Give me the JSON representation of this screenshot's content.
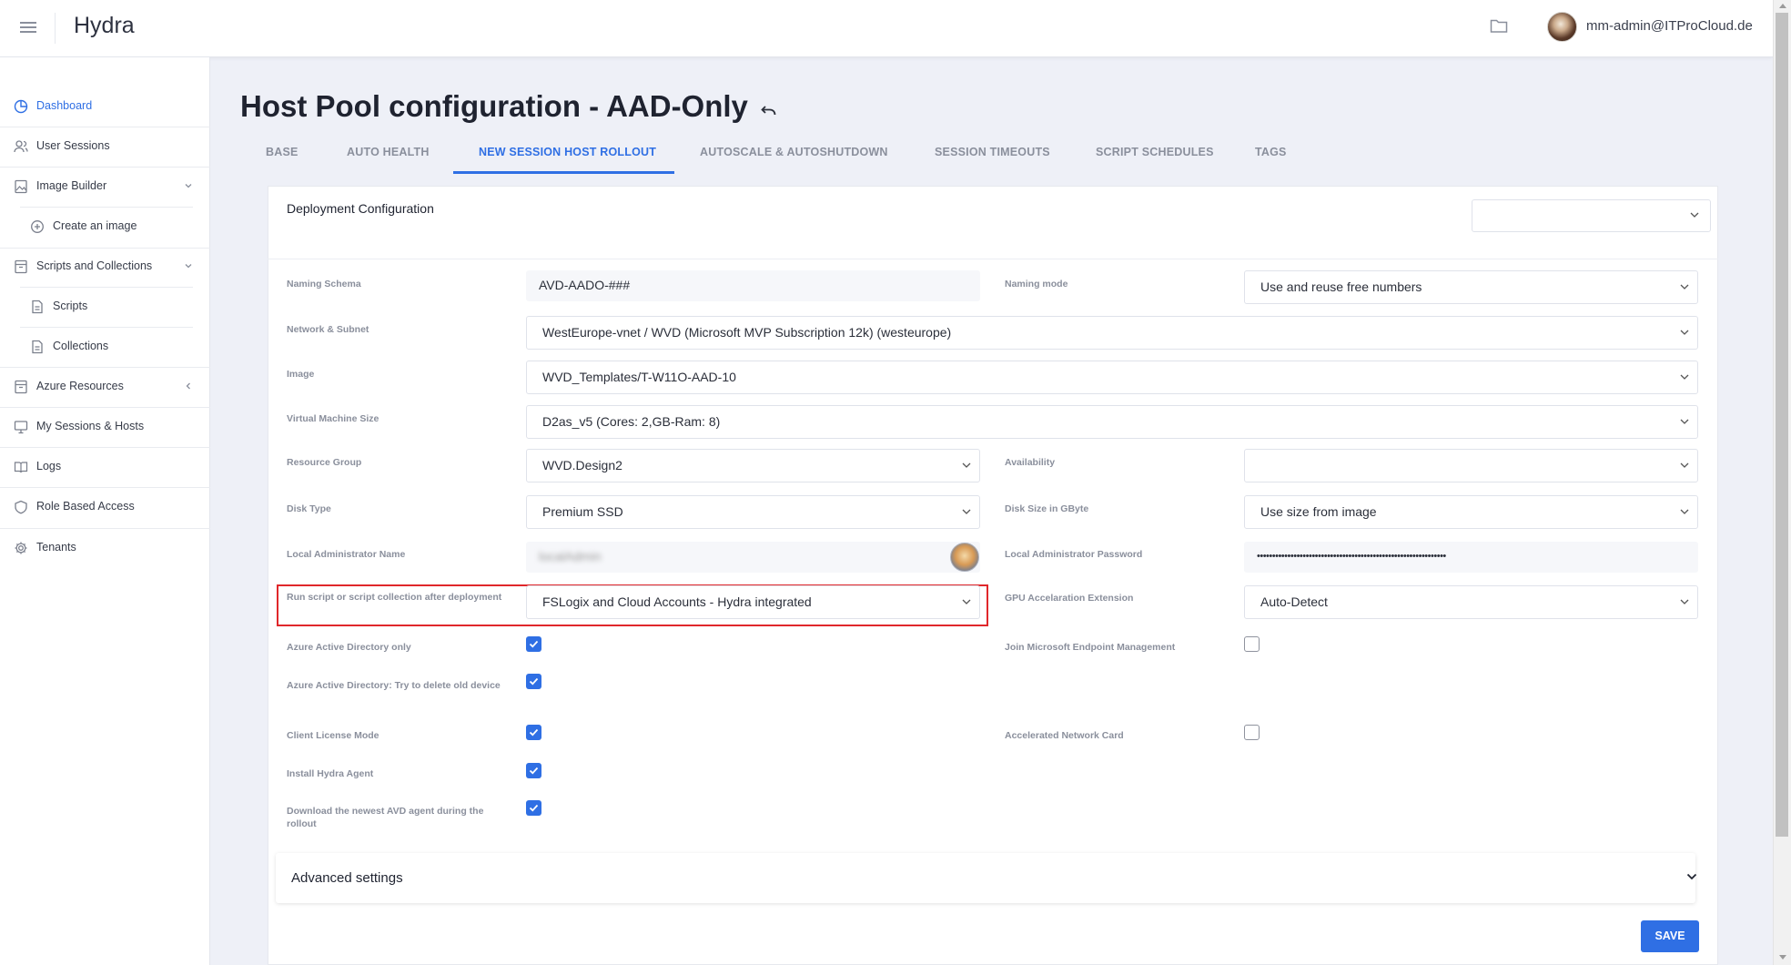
{
  "app": {
    "title": "Hydra"
  },
  "header": {
    "user": "mm-admin@ITProCloud.de"
  },
  "sidebar": {
    "items": [
      {
        "label": "Dashboard",
        "icon": "dashboard-icon"
      },
      {
        "label": "User Sessions",
        "icon": "users-icon"
      },
      {
        "label": "Image Builder",
        "icon": "image-builder-icon"
      },
      {
        "label": "Create an image",
        "icon": "plus-circle-icon"
      },
      {
        "label": "Scripts and Collections",
        "icon": "archive-icon"
      },
      {
        "label": "Scripts",
        "icon": "file-icon"
      },
      {
        "label": "Collections",
        "icon": "file-icon"
      },
      {
        "label": "Azure Resources",
        "icon": "archive-icon"
      },
      {
        "label": "My Sessions & Hosts",
        "icon": "monitor-icon"
      },
      {
        "label": "Logs",
        "icon": "book-icon"
      },
      {
        "label": "Role Based Access",
        "icon": "shield-icon"
      },
      {
        "label": "Tenants",
        "icon": "gear-icon"
      }
    ]
  },
  "page": {
    "title": "Host Pool configuration - AAD-Only"
  },
  "tabs": [
    {
      "label": "BASE"
    },
    {
      "label": "AUTO HEALTH"
    },
    {
      "label": "NEW SESSION HOST ROLLOUT"
    },
    {
      "label": "AUTOSCALE & AUTOSHUTDOWN"
    },
    {
      "label": "SESSION TIMEOUTS"
    },
    {
      "label": "SCRIPT SCHEDULES"
    },
    {
      "label": "TAGS"
    }
  ],
  "active_tab": "NEW SESSION HOST ROLLOUT",
  "card": {
    "title": "Deployment Configuration",
    "top_select_value": ""
  },
  "form": {
    "naming_schema": {
      "label": "Naming Schema",
      "value": "AVD-AADO-###"
    },
    "naming_mode": {
      "label": "Naming mode",
      "value": "Use and reuse free numbers"
    },
    "network": {
      "label": "Network & Subnet",
      "value": "WestEurope-vnet / WVD (Microsoft MVP Subscription 12k) (westeurope)"
    },
    "image": {
      "label": "Image",
      "value": "WVD_Templates/T-W11O-AAD-10"
    },
    "vm_size": {
      "label": "Virtual Machine Size",
      "value": "D2as_v5 (Cores: 2,GB-Ram: 8)"
    },
    "resource_group": {
      "label": "Resource Group",
      "value": "WVD.Design2"
    },
    "availability": {
      "label": "Availability",
      "value": ""
    },
    "disk_type": {
      "label": "Disk Type",
      "value": "Premium SSD"
    },
    "disk_size": {
      "label": "Disk Size in GByte",
      "value": "Use size from image"
    },
    "local_admin_name": {
      "label": "Local Administrator Name",
      "value": "localAdmin"
    },
    "local_admin_password": {
      "label": "Local Administrator Password",
      "value": "••••••••••••••••••••••••••••••••••••••••••••••••••••••••••••••"
    },
    "run_script": {
      "label": "Run script or script collection after deployment",
      "value": "FSLogix and Cloud Accounts - Hydra integrated"
    },
    "gpu_ext": {
      "label": "GPU Accelaration Extension",
      "value": "Auto-Detect"
    },
    "aad_only": {
      "label": "Azure Active Directory only",
      "checked": true
    },
    "join_mem": {
      "label": "Join Microsoft Endpoint Management",
      "checked": false
    },
    "aad_delete": {
      "label": "Azure Active Directory: Try to delete old device",
      "checked": true
    },
    "client_license": {
      "label": "Client License Mode",
      "checked": true
    },
    "accel_net": {
      "label": "Accelerated Network Card",
      "checked": false
    },
    "install_agent": {
      "label": "Install Hydra Agent",
      "checked": true
    },
    "download_agent": {
      "label": "Download the newest AVD agent during the rollout",
      "checked": true
    }
  },
  "advanced": {
    "label": "Advanced settings"
  },
  "save": {
    "label": "SAVE"
  },
  "colors": {
    "accent": "#2f6fe4",
    "highlight_border": "#e0272b",
    "background": "#eef0f7"
  }
}
